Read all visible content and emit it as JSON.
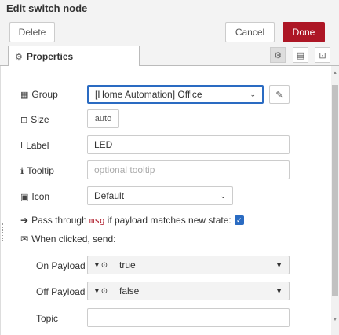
{
  "tray": {
    "title": "Edit switch node"
  },
  "toolbar": {
    "delete_label": "Delete",
    "cancel_label": "Cancel",
    "done_label": "Done"
  },
  "tabs": {
    "properties_label": "Properties"
  },
  "form": {
    "group": {
      "label": "Group",
      "value": "[Home Automation] Office"
    },
    "size": {
      "label": "Size",
      "value": "auto"
    },
    "label_field": {
      "label": "Label",
      "value": "LED"
    },
    "tooltip": {
      "label": "Tooltip",
      "placeholder": "optional tooltip"
    },
    "icon": {
      "label": "Icon",
      "value": "Default"
    },
    "pass_through": {
      "prefix": "Pass through",
      "code": "msg",
      "suffix": "if payload matches new state:",
      "checked": true
    },
    "when_clicked": {
      "label": "When clicked, send:"
    },
    "on_payload": {
      "label": "On Payload",
      "value": "true"
    },
    "off_payload": {
      "label": "Off Payload",
      "value": "false"
    },
    "topic": {
      "label": "Topic",
      "value": ""
    }
  },
  "colors": {
    "done_button": "#ad1625",
    "focus_border": "#2a6bc2",
    "checkbox": "#2a6bc2"
  }
}
